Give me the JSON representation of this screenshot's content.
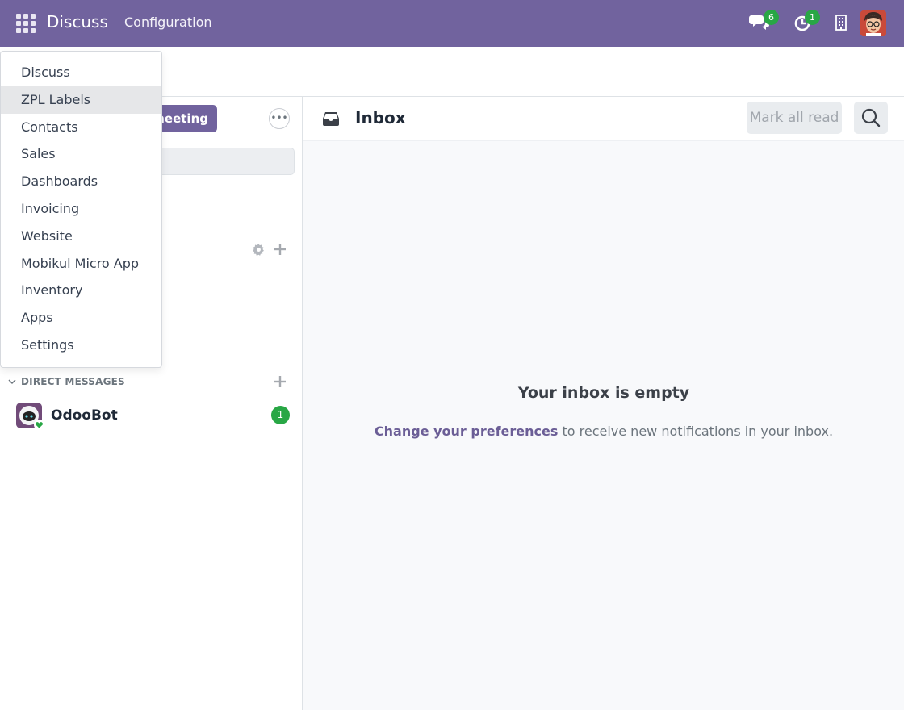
{
  "navbar": {
    "brand": "Discuss",
    "menu_configuration": "Configuration",
    "messages_count": "6",
    "activities_count": "1"
  },
  "app_menu": {
    "items": [
      "Discuss",
      "ZPL Labels",
      "Contacts",
      "Sales",
      "Dashboards",
      "Invoicing",
      "Website",
      "Mobikul Micro App",
      "Inventory",
      "Apps",
      "Settings"
    ],
    "highlighted": "ZPL Labels"
  },
  "sidebar": {
    "meeting_button_visible_text": "meeting",
    "direct_messages_header": "DIRECT MESSAGES",
    "direct_messages": [
      {
        "name": "OdooBot",
        "unread": "1"
      }
    ]
  },
  "thread": {
    "title": "Inbox",
    "mark_all_read": "Mark all read",
    "empty_title": "Your inbox is empty",
    "empty_link": "Change your preferences",
    "empty_text": " to receive new notifications in your inbox."
  },
  "colors": {
    "brand_purple": "#71639e",
    "badge_green": "#28a745"
  }
}
